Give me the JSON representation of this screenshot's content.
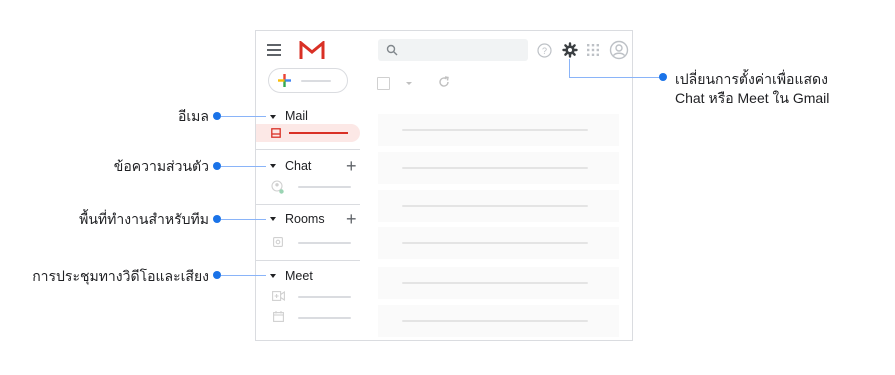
{
  "callouts": {
    "mail": "อีเมล",
    "chat": "ข้อความส่วนตัว",
    "rooms": "พื้นที่ทำงานสำหรับทีม",
    "meet": "การประชุมทางวิดีโอและเสียง",
    "settings_line1": "เปลี่ยนการตั้งค่าเพื่อแสดง",
    "settings_line2": "Chat หรือ Meet ใน Gmail"
  },
  "sidebar": {
    "sections": [
      {
        "label": "Mail"
      },
      {
        "label": "Chat"
      },
      {
        "label": "Rooms"
      },
      {
        "label": "Meet"
      }
    ]
  },
  "icons": {
    "menu": "hamburger-icon",
    "logo": "gmail-logo",
    "search": "search-icon",
    "help": "help-icon",
    "settings": "gear-icon",
    "apps": "apps-grid-icon",
    "account": "account-icon",
    "compose": "plus-icon"
  },
  "colors": {
    "accent": "#1a73e8",
    "mail_red": "#d93025",
    "inbox_highlight": "#fce8e6"
  }
}
